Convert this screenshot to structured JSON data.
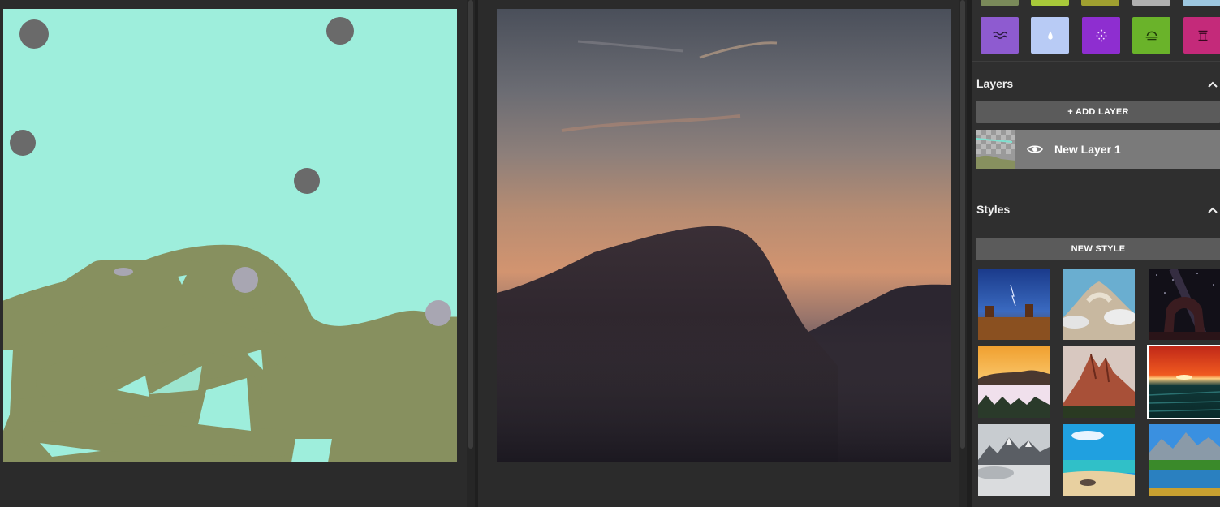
{
  "panels": {
    "segmentation": {
      "label": ""
    },
    "output": {
      "label": ""
    }
  },
  "materials": {
    "top_row_colors": [
      "#7a8a5a",
      "#a8c93a",
      "#a0a030",
      "#b0b0b0",
      "#9ec8e0"
    ],
    "items": [
      {
        "name": "water",
        "icon": "waves-icon",
        "color": "#8e5bd0"
      },
      {
        "name": "drop",
        "icon": "drop-icon",
        "color": "#b8cbf5"
      },
      {
        "name": "snow",
        "icon": "sparkle-icon",
        "color": "#8e2ed0"
      },
      {
        "name": "fog",
        "icon": "fog-icon",
        "color": "#6ab32a"
      },
      {
        "name": "bridge",
        "icon": "bridge-icon",
        "color": "#c42a7a"
      }
    ]
  },
  "layers": {
    "title": "Layers",
    "add_label": "+ ADD LAYER",
    "items": [
      {
        "name": "New Layer 1",
        "visible": true
      }
    ]
  },
  "styles": {
    "title": "Styles",
    "new_label": "NEW STYLE",
    "selected_index": 5,
    "items": [
      {
        "name": "desert-storm"
      },
      {
        "name": "cloud-peak"
      },
      {
        "name": "night-arch"
      },
      {
        "name": "sunrise-fog"
      },
      {
        "name": "red-peaks"
      },
      {
        "name": "sunset-sea"
      },
      {
        "name": "misty-mountains"
      },
      {
        "name": "tropical-beach"
      },
      {
        "name": "alpine-lake"
      }
    ]
  },
  "colors": {
    "sky": "#9eeedc",
    "ground": "#87905f",
    "stone": "#6a6a6a",
    "light_stone": "#a8a6b2"
  }
}
